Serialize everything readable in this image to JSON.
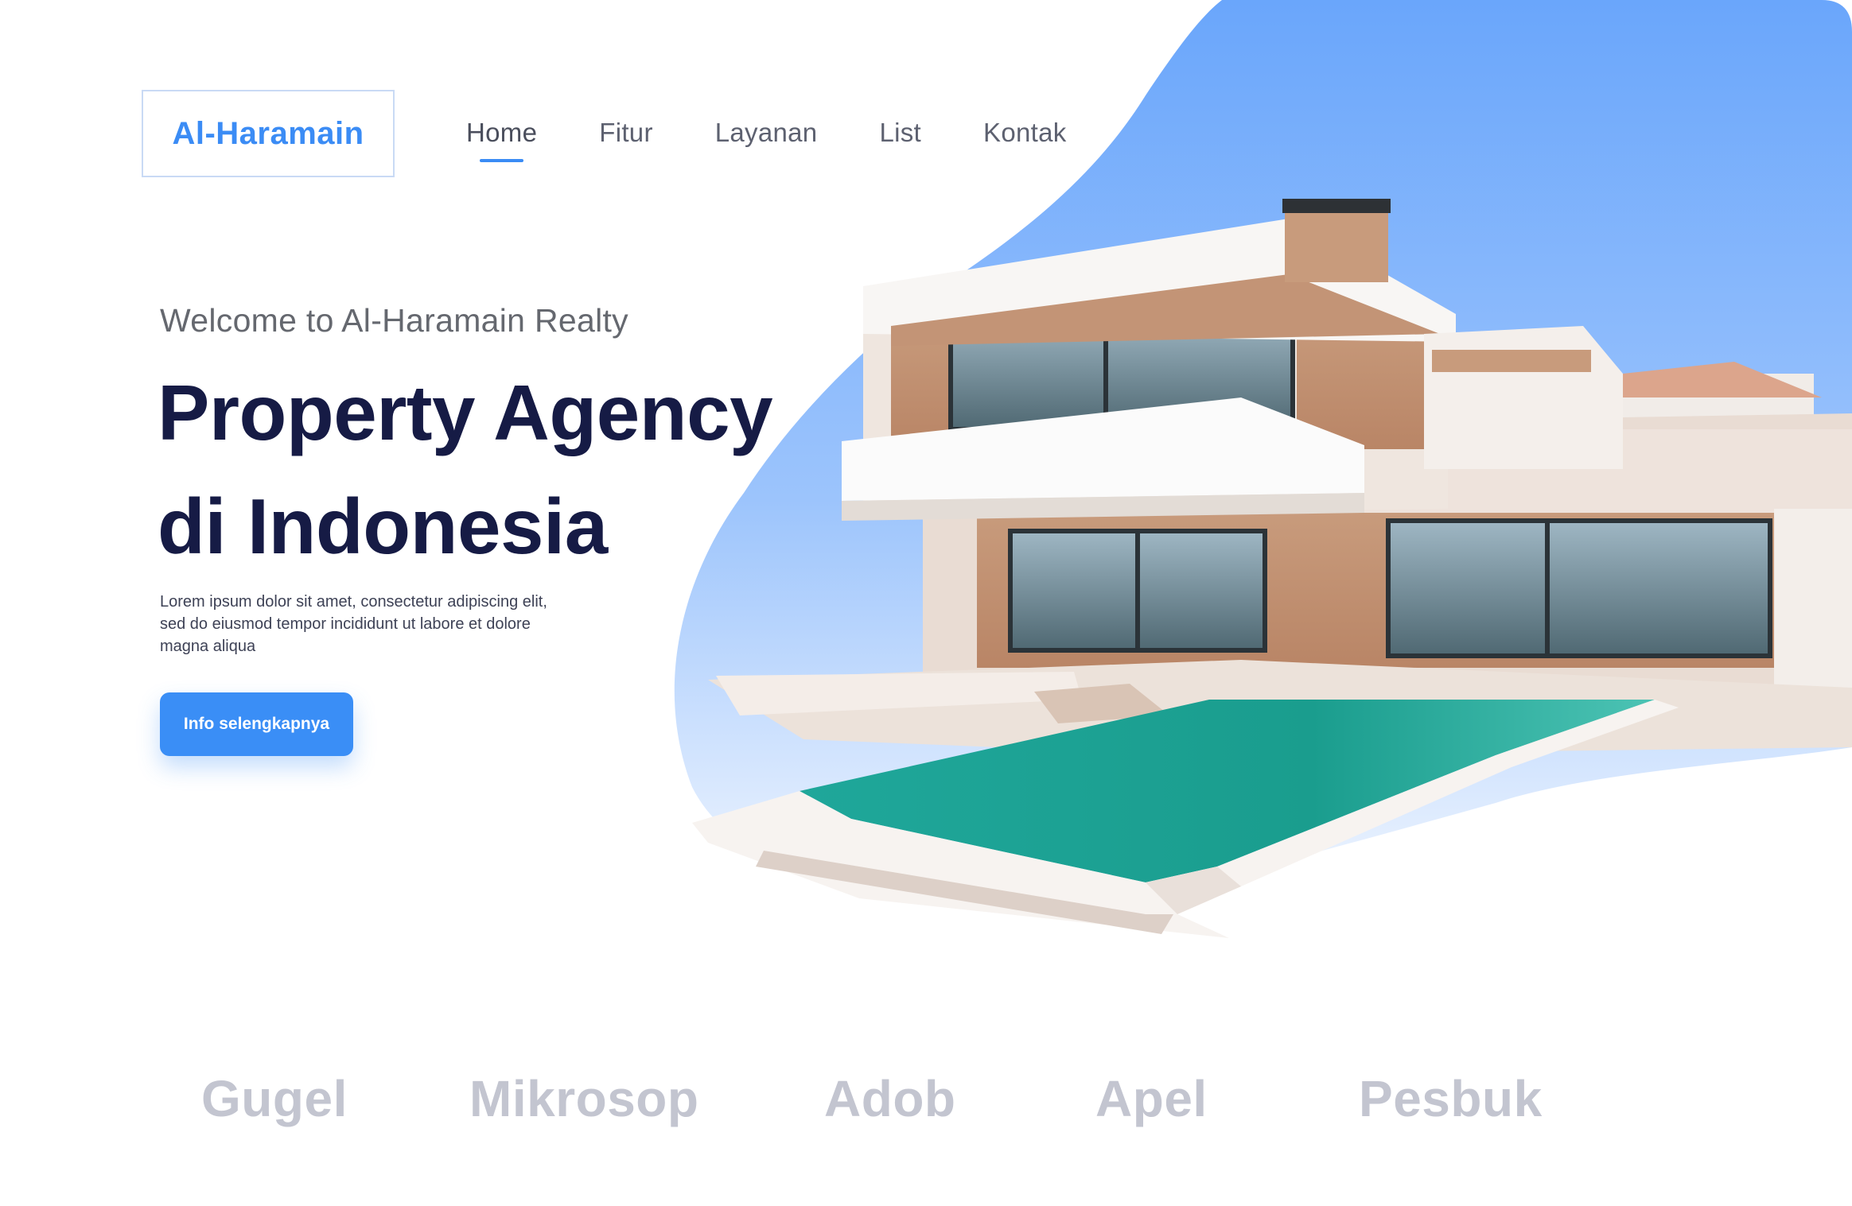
{
  "header": {
    "logo_text": "Al-Haramain",
    "nav": [
      {
        "label": "Home",
        "active": true
      },
      {
        "label": "Fitur",
        "active": false
      },
      {
        "label": "Layanan",
        "active": false
      },
      {
        "label": "List",
        "active": false
      },
      {
        "label": "Kontak",
        "active": false
      }
    ]
  },
  "hero": {
    "eyebrow": "Welcome to Al-Haramain Realty",
    "headline_line1": "Property Agency",
    "headline_line2": "di Indonesia",
    "description": "Lorem ipsum dolor sit amet, consectetur adipiscing elit, sed do eiusmod tempor incididunt ut labore et dolore magna aliqua",
    "cta_label": "Info selengkapnya",
    "image_subject": "modern white villa with infinity swimming pool"
  },
  "partners": [
    "Gugel",
    "Mikrosop",
    "Adob",
    "Apel",
    "Pesbuk"
  ],
  "colors": {
    "accent": "#3b8cf5",
    "headline": "#161b45",
    "nav_text": "#5d6170",
    "partner_text": "#c3c5d0",
    "blob_top": "#6ea8fb",
    "blob_bottom": "#eef5ff"
  }
}
